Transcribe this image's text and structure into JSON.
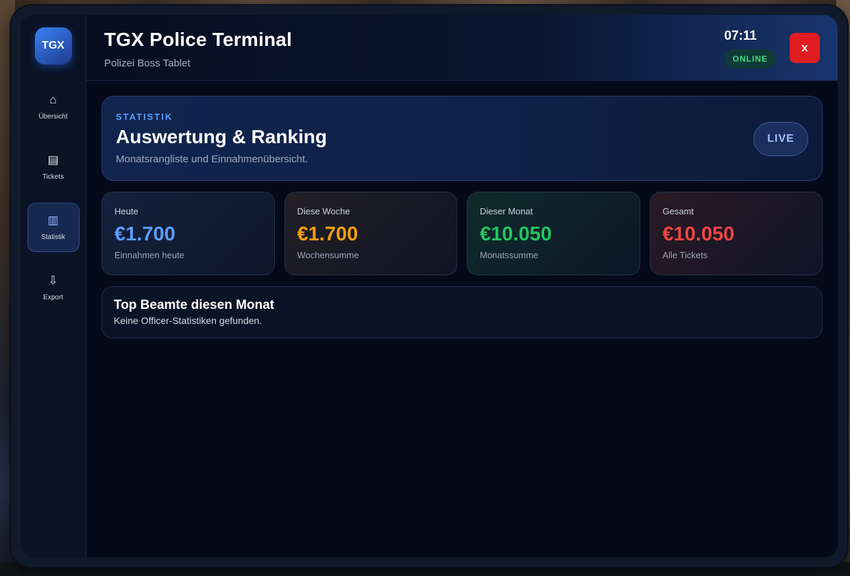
{
  "app": {
    "logo": "TGX",
    "title": "TGX Police Terminal",
    "subtitle": "Polizei Boss Tablet",
    "clock": "07:11",
    "status": "ONLINE",
    "close_label": "x"
  },
  "sidebar": {
    "items": [
      {
        "label": "Übersicht",
        "icon": "home-icon",
        "glyph": "⌂",
        "active": false
      },
      {
        "label": "Tickets",
        "icon": "list-icon",
        "glyph": "▤",
        "active": false
      },
      {
        "label": "Statistik",
        "icon": "bars-icon",
        "glyph": "▥",
        "active": true
      },
      {
        "label": "Export",
        "icon": "download-icon",
        "glyph": "⇩",
        "active": false
      }
    ]
  },
  "hero": {
    "eyebrow": "STATISTIK",
    "title": "Auswertung & Ranking",
    "description": "Monatsrangliste und Einnahmenübersicht.",
    "badge": "LIVE"
  },
  "stats": [
    {
      "label": "Heute",
      "value": "€1.700",
      "sub": "Einnahmen heute",
      "color": "#5b9dff"
    },
    {
      "label": "Diese Woche",
      "value": "€1.700",
      "sub": "Wochensumme",
      "color": "#f59e0b"
    },
    {
      "label": "Dieser Monat",
      "value": "€10.050",
      "sub": "Monatssumme",
      "color": "#22c55e"
    },
    {
      "label": "Gesamt",
      "value": "€10.050",
      "sub": "Alle Tickets",
      "color": "#ef4444"
    }
  ],
  "ranking": {
    "title": "Top Beamte diesen Monat",
    "empty_text": "Keine Officer-Statistiken gefunden."
  }
}
